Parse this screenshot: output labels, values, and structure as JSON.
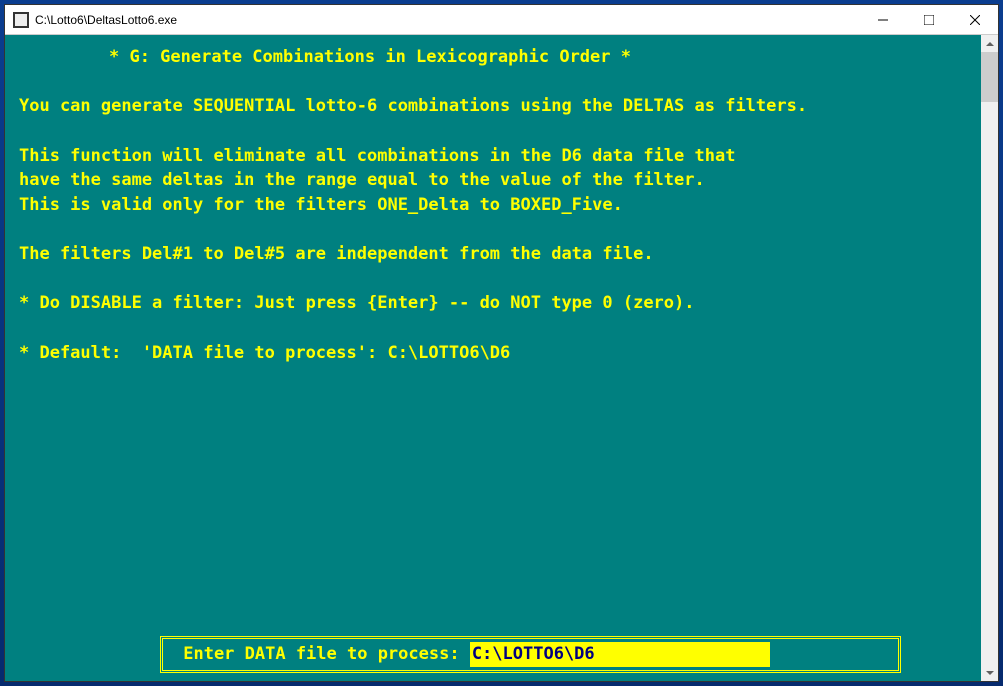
{
  "window": {
    "title": "C:\\Lotto6\\DeltasLotto6.exe"
  },
  "console": {
    "header": "* G: Generate Combinations in Lexicographic Order *",
    "line1": "You can generate SEQUENTIAL lotto-6 combinations using the DELTAS as filters.",
    "line2": "This function will eliminate all combinations in the D6 data file that",
    "line3": "have the same deltas in the range equal to the value of the filter.",
    "line4": "This is valid only for the filters ONE_Delta to BOXED_Five.",
    "line5": "The filters Del#1 to Del#5 are independent from the data file.",
    "line6": "* Do DISABLE a filter: Just press {Enter} -- do NOT type 0 (zero).",
    "line7": "* Default:  'DATA file to process': C:\\LOTTO6\\D6",
    "input_prompt": " Enter DATA file to process: ",
    "input_value": "C:\\LOTTO6\\D6"
  }
}
